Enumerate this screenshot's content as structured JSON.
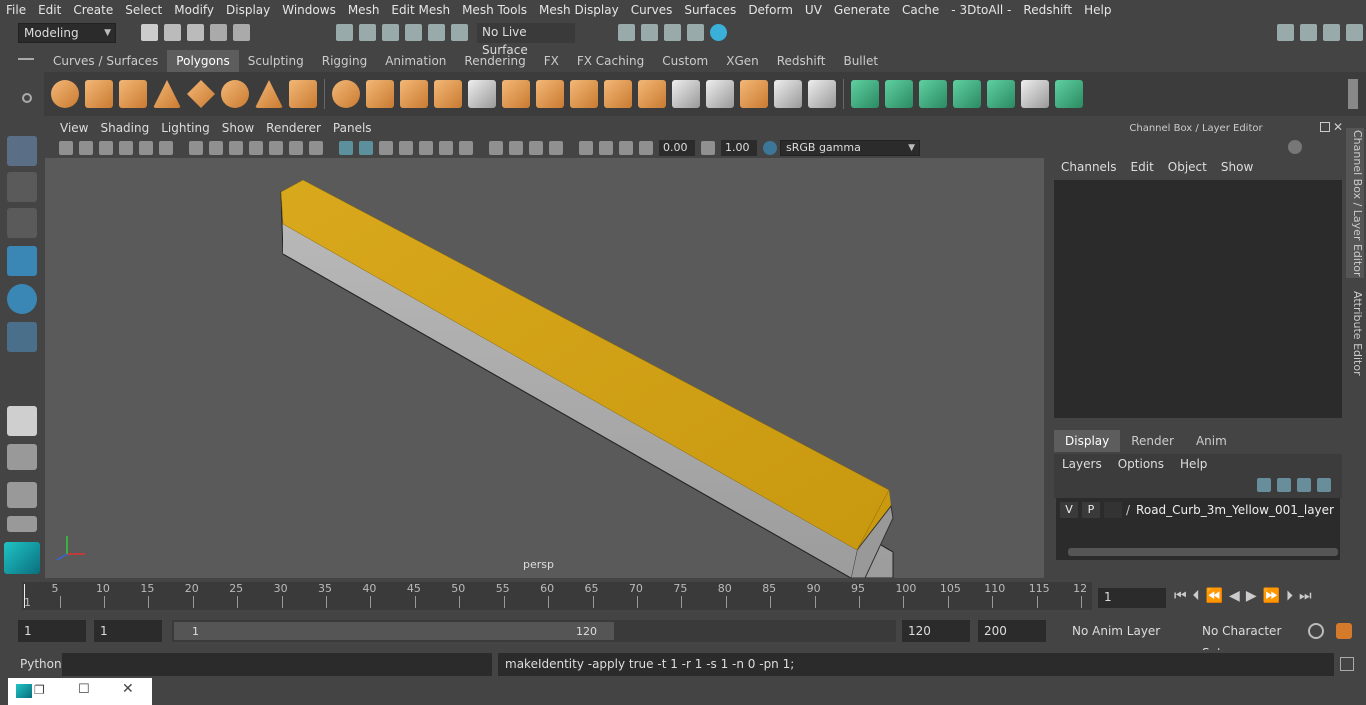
{
  "menubar": [
    "File",
    "Edit",
    "Create",
    "Select",
    "Modify",
    "Display",
    "Windows",
    "Mesh",
    "Edit Mesh",
    "Mesh Tools",
    "Mesh Display",
    "Curves",
    "Surfaces",
    "Deform",
    "UV",
    "Generate",
    "Cache",
    "- 3DtoAll -",
    "Redshift",
    "Help"
  ],
  "status": {
    "mode": "Modeling",
    "live_surface": "No Live Surface"
  },
  "shelf_tabs": [
    "Curves / Surfaces",
    "Polygons",
    "Sculpting",
    "Rigging",
    "Animation",
    "Rendering",
    "FX",
    "FX Caching",
    "Custom",
    "XGen",
    "Redshift",
    "Bullet"
  ],
  "panel_menu": [
    "View",
    "Shading",
    "Lighting",
    "Show",
    "Renderer",
    "Panels"
  ],
  "panel_toolbar": {
    "exposure": "0.00",
    "gamma": "1.00",
    "color_space": "sRGB gamma"
  },
  "viewport": {
    "camera_label": "persp"
  },
  "right_panel": {
    "title": "Channel Box / Layer Editor",
    "menus": [
      "Channels",
      "Edit",
      "Object",
      "Show"
    ],
    "tabs": [
      "Display",
      "Render",
      "Anim"
    ],
    "layer_menus": [
      "Layers",
      "Options",
      "Help"
    ],
    "layer": {
      "v": "V",
      "p": "P",
      "name": "Road_Curb_3m_Yellow_001_layer"
    }
  },
  "side_tabs": {
    "channel_box": "Channel Box / Layer Editor",
    "attribute_editor": "Attribute Editor"
  },
  "timeline": {
    "ticks": [
      "5",
      "10",
      "15",
      "20",
      "25",
      "30",
      "35",
      "40",
      "45",
      "50",
      "55",
      "60",
      "65",
      "70",
      "75",
      "80",
      "85",
      "90",
      "95",
      "100",
      "105",
      "110",
      "115",
      "12"
    ],
    "start_label": "1",
    "current_frame": "1"
  },
  "range": {
    "start": "1",
    "start2": "1",
    "slider_start": "1",
    "slider_end": "120",
    "end": "120",
    "end2": "200",
    "anim_layer": "No Anim Layer",
    "char_set": "No Character Set"
  },
  "cmd": {
    "lang": "Python",
    "output": "makeIdentity -apply true -t 1 -r 1 -s 1 -n 0 -pn 1;"
  }
}
